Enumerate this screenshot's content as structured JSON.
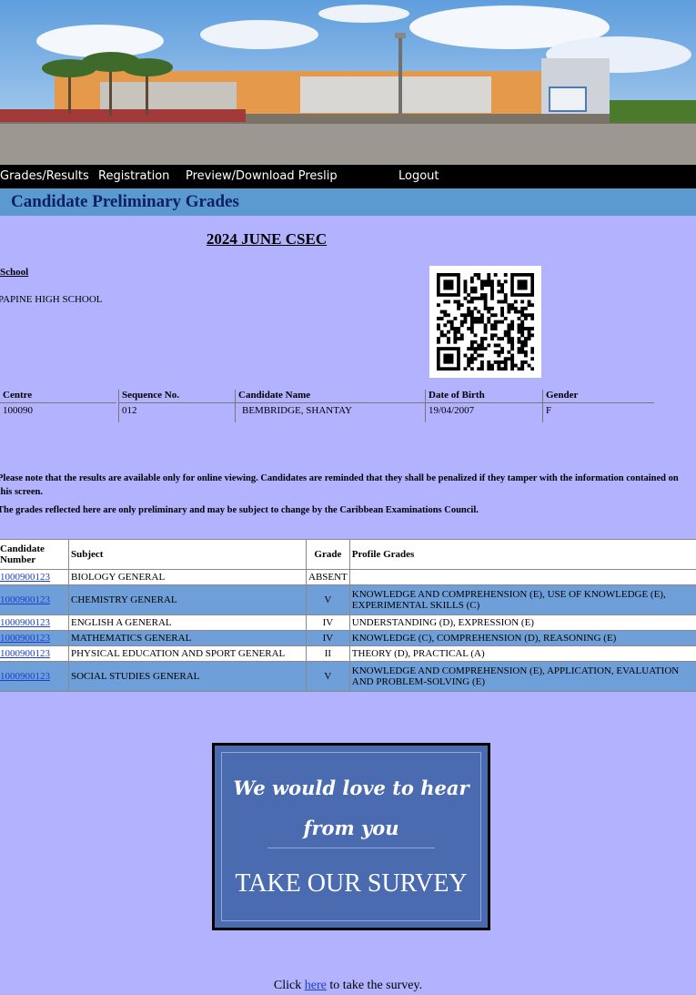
{
  "nav": {
    "items": [
      {
        "label": "Grades/Results"
      },
      {
        "label": "Registration"
      },
      {
        "label": "Preview/Download Preslip"
      },
      {
        "label": "Logout"
      }
    ]
  },
  "page_title": "Candidate Preliminary Grades",
  "exam_title": "2024 JUNE CSEC",
  "school": {
    "label": "School",
    "name": "PAPINE HIGH SCHOOL"
  },
  "candidate": {
    "headers": [
      "Centre",
      "Sequence No.",
      "Candidate Name",
      "Date of Birth",
      "Gender"
    ],
    "values": [
      "100090",
      "012",
      "BEMBRIDGE, SHANTAY",
      "19/04/2007",
      "F"
    ]
  },
  "notices": [
    "Please note that the results are available only for online viewing. Candidates are reminded that they shall be penalized if they tamper with the information contained on this screen.",
    "The grades reflected here are only preliminary and may be subject to change by the Caribbean Examinations Council."
  ],
  "grades": {
    "headers": [
      "Candidate Number",
      "Subject",
      "Grade",
      "Profile Grades"
    ],
    "rows": [
      {
        "number": "1000900123",
        "subject": "BIOLOGY GENERAL",
        "grade": "ABSENT",
        "profile": ""
      },
      {
        "number": "1000900123",
        "subject": "CHEMISTRY GENERAL",
        "grade": "V",
        "profile": "KNOWLEDGE AND COMPREHENSION (E), USE OF KNOWLEDGE (E), EXPERIMENTAL SKILLS (C)"
      },
      {
        "number": "1000900123",
        "subject": "ENGLISH A GENERAL",
        "grade": "IV",
        "profile": "UNDERSTANDING (D), EXPRESSION (E)"
      },
      {
        "number": "1000900123",
        "subject": "MATHEMATICS GENERAL",
        "grade": "IV",
        "profile": "KNOWLEDGE (C), COMPREHENSION (D), REASONING (E)"
      },
      {
        "number": "1000900123",
        "subject": "PHYSICAL EDUCATION AND SPORT GENERAL",
        "grade": "II",
        "profile": "THEORY (D), PRACTICAL (A)"
      },
      {
        "number": "1000900123",
        "subject": "SOCIAL STUDIES GENERAL",
        "grade": "V",
        "profile": "KNOWLEDGE AND COMPREHENSION (E), APPLICATION, EVALUATION AND PROBLEM-SOLVING (E)"
      }
    ]
  },
  "survey": {
    "line1": "We would love to hear",
    "line2": "from you",
    "cta": "TAKE OUR SURVEY",
    "click_prefix": "Click",
    "click_link": "here",
    "click_suffix": "to take the survey."
  },
  "colors": {
    "page_bg": "#b2b2ff",
    "nav_bg": "#000000",
    "title_bar": "#5b9ad1",
    "row_alt": "#6f9fd8",
    "survey_bg": "#4a6bb0"
  }
}
